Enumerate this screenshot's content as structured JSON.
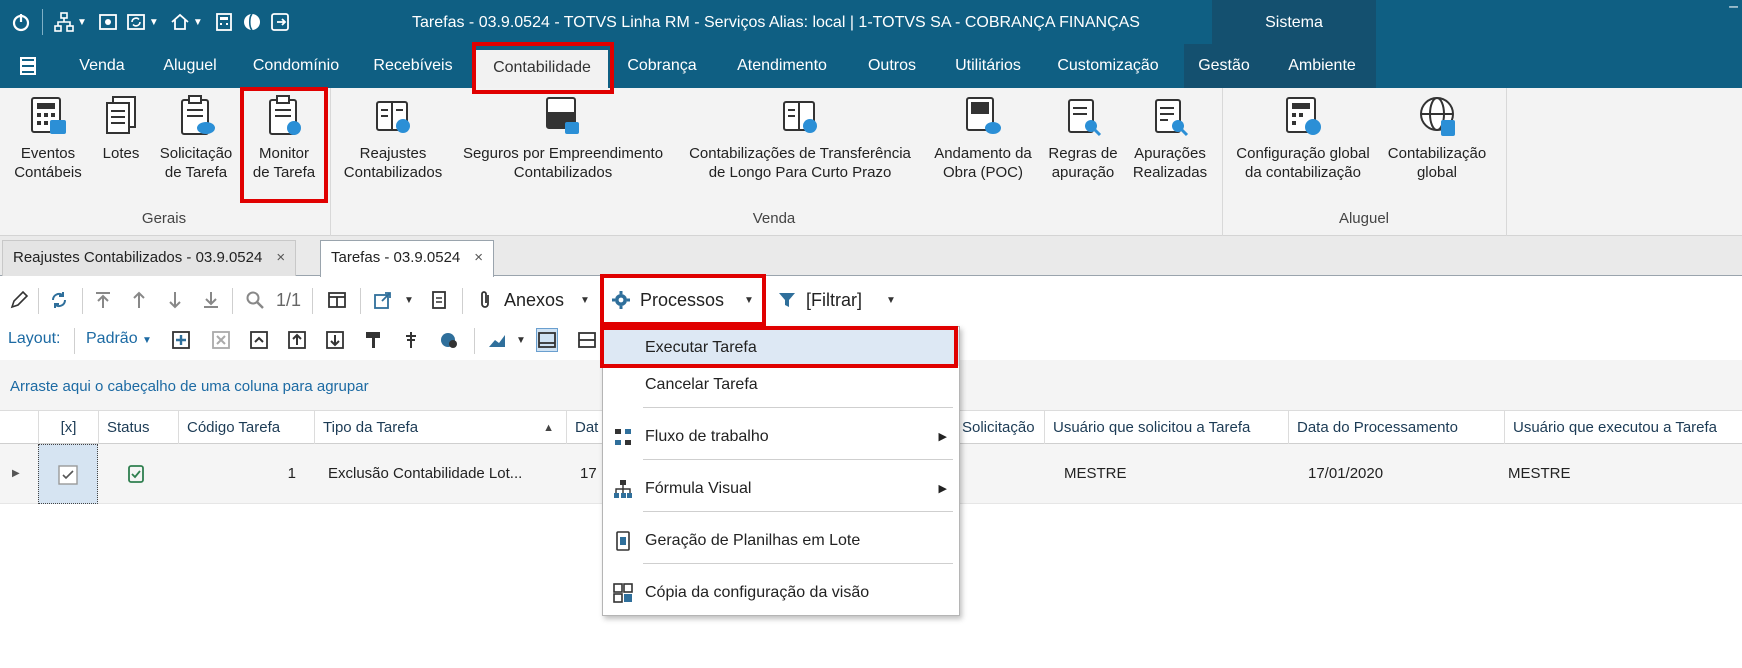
{
  "window": {
    "title": "Tarefas - 03.9.0524 - TOTVS Linha RM - Serviços  Alias: local | 1-TOTVS SA - COBRANÇA FINANÇAS",
    "system_tab": "Sistema",
    "minimize_glyph": "–"
  },
  "menu": {
    "items": [
      {
        "label": "Venda"
      },
      {
        "label": "Aluguel"
      },
      {
        "label": "Condomínio"
      },
      {
        "label": "Recebíveis"
      },
      {
        "label": "Contabilidade",
        "active": true
      },
      {
        "label": "Cobrança"
      },
      {
        "label": "Atendimento"
      },
      {
        "label": "Outros"
      },
      {
        "label": "Utilitários"
      },
      {
        "label": "Customização"
      },
      {
        "label": "Gestão"
      },
      {
        "label": "Ambiente"
      }
    ]
  },
  "ribbon": {
    "gerais": {
      "label": "Gerais",
      "buttons": [
        {
          "line1": "Eventos",
          "line2": "Contábeis",
          "icon": "calculator-doc-icon"
        },
        {
          "line1": "Lotes",
          "line2": "",
          "icon": "stacked-docs-icon"
        },
        {
          "line1": "Solicitação",
          "line2": "de Tarefa",
          "icon": "clipboard-cloud-icon"
        },
        {
          "line1": "Monitor",
          "line2": "de Tarefa",
          "icon": "clipboard-monitor-icon"
        }
      ]
    },
    "venda": {
      "label": "Venda",
      "buttons": [
        {
          "line1": "Reajustes",
          "line2": "Contabilizados",
          "icon": "ledger-coin-icon"
        },
        {
          "line1": "Seguros por Empreendimento",
          "line2": "Contabilizados",
          "icon": "ledger-lock-icon"
        },
        {
          "line1": "Contabilizações de Transferência",
          "line2": "de Longo Para Curto Prazo",
          "icon": "ledger-clock-icon"
        },
        {
          "line1": "Andamento da",
          "line2": "Obra (POC)",
          "icon": "doc-gauge-icon"
        },
        {
          "line1": "Regras de",
          "line2": "apuração",
          "icon": "doc-search-icon"
        },
        {
          "line1": "Apurações",
          "line2": "Realizadas",
          "icon": "doc-search-list-icon"
        }
      ]
    },
    "aluguel": {
      "label": "Aluguel",
      "buttons": [
        {
          "line1": "Configuração global",
          "line2": "da contabilização",
          "icon": "calculator-globe-icon"
        },
        {
          "line1": "Contabilização",
          "line2": "global",
          "icon": "globe-doc-icon"
        }
      ]
    }
  },
  "tabs": [
    {
      "label": "Reajustes Contabilizados - 03.9.0524",
      "close": "×"
    },
    {
      "label": "Tarefas - 03.9.0524",
      "close": "×",
      "active": true
    }
  ],
  "toolbar": {
    "page_counter": "1/1",
    "anexos": "Anexos",
    "processos": "Processos",
    "filtrar": "[Filtrar]",
    "layout_label": "Layout:",
    "layout_value": "Padrão"
  },
  "group_hint": "Arraste aqui o cabeçalho de uma coluna para agrupar",
  "grid": {
    "columns": [
      "[x]",
      "Status",
      "Código Tarefa",
      "Tipo da Tarefa",
      "Dat",
      "Solicitação",
      "Usuário que solicitou a Tarefa",
      "Data do Processamento",
      "Usuário que executou a Tarefa"
    ],
    "rows": [
      {
        "codigo": "1",
        "tipo": "Exclusão Contabilidade Lot...",
        "data": "17",
        "usuario_solicitou": "MESTRE",
        "data_processamento": "17/01/2020",
        "usuario_executou": "MESTRE"
      }
    ]
  },
  "processos_menu": {
    "items": [
      {
        "label": "Executar Tarefa",
        "highlighted": true
      },
      {
        "label": "Cancelar Tarefa"
      },
      {
        "label": "Fluxo de trabalho",
        "submenu": true,
        "icon": "workflow-icon"
      },
      {
        "label": "Fórmula Visual",
        "submenu": true,
        "icon": "hierarchy-icon"
      },
      {
        "label": "Geração de Planilhas em Lote",
        "icon": "spreadsheet-icon"
      },
      {
        "label": "Cópia da configuração da visão",
        "icon": "grid-copy-icon"
      }
    ]
  },
  "colors": {
    "titlebar": "#0f5f83",
    "system_area": "#14506f",
    "highlight_box": "#e00000",
    "menu_hover": "#dde8f4",
    "link_blue": "#1c6aa3"
  }
}
